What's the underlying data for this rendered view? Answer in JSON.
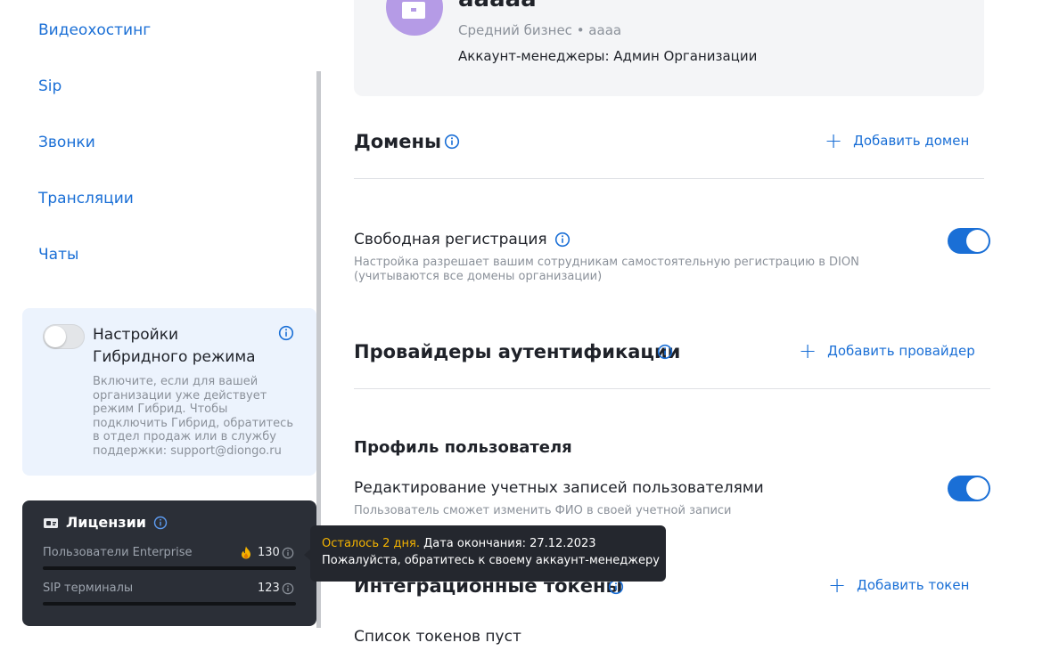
{
  "sidebar": {
    "nav_items": [
      "Видеохостинг",
      "Sip",
      "Звонки",
      "Трансляции",
      "Чаты"
    ],
    "hybrid": {
      "title_line1": "Настройки",
      "title_line2": "Гибридного режима",
      "description_lines": [
        "Включите, если для вашей",
        "организации уже действует",
        "режим Гибрид. Чтобы",
        "подключить Гибрид, обратитесь",
        "в отдел продаж или в службу",
        "поддержки: support@diongo.ru"
      ],
      "enabled": false
    },
    "licenses": {
      "title": "Лицензии",
      "rows": [
        {
          "label": "Пользователи Enterprise",
          "value": "130",
          "fire": true
        },
        {
          "label": "SIP терминалы",
          "value": "123",
          "fire": false
        }
      ]
    }
  },
  "tooltip": {
    "warning": "Осталось 2 дня.",
    "expiry": "Дата окончания: 27.12.2023",
    "line2": "Пожалуйста, обратитесь к своему аккаунт-менеджеру"
  },
  "org": {
    "name": "aaaaa",
    "subtitle": "Средний бизнес • aaaa",
    "managers": "Аккаунт-менеджеры: Админ Организации"
  },
  "domains": {
    "title": "Домены",
    "add_label": "Добавить домен"
  },
  "free_registration": {
    "title": "Свободная регистрация",
    "desc_line1": "Настройка разрешает вашим сотрудникам самостоятельную регистрацию в DION",
    "desc_line2": "(учитываются все домены организации)",
    "enabled": true
  },
  "auth_providers": {
    "title": "Провайдеры аутентификации",
    "add_label": "Добавить провайдер"
  },
  "user_profile": {
    "title": "Профиль пользователя",
    "edit_title": "Редактирование учетных записей пользователями",
    "edit_desc": "Пользователь сможет изменить ФИО в своей учетной записи",
    "enabled": true
  },
  "tokens": {
    "title": "Интеграционные токены",
    "add_label": "Добавить токен",
    "empty_text": "Список токенов пуст"
  },
  "colors": {
    "accent": "#1a6fd6",
    "warning": "#f5b400",
    "avatar": "#b59be6"
  }
}
